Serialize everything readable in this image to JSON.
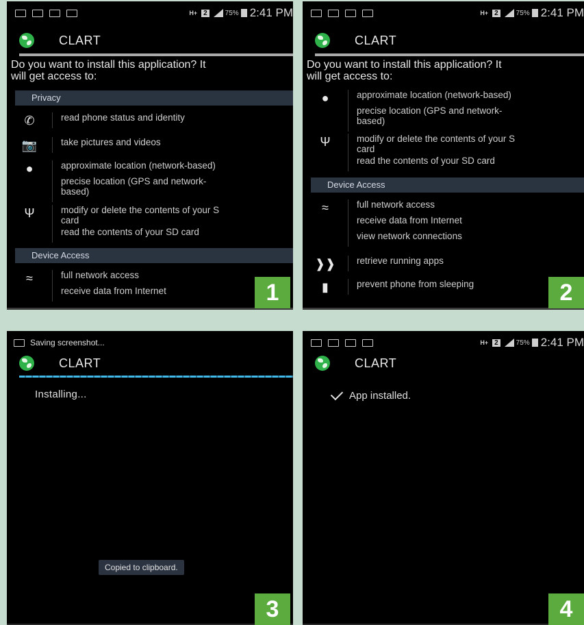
{
  "status_bar": {
    "battery": "75%",
    "time": "2:41 PM",
    "network": "H+",
    "sim": "2",
    "saving": "Saving screenshot..."
  },
  "app": {
    "name": "CLART"
  },
  "install_prompt": {
    "question_line1": "Do you want to install this application? It",
    "question_line2": "will get access to:"
  },
  "sections": {
    "privacy": "Privacy",
    "device_access": "Device Access"
  },
  "permissions": {
    "phone_status": "read phone status and identity",
    "camera": "take pictures and videos",
    "approx_location": "approximate location (network-based)",
    "precise_location_1": "precise location (GPS and network-",
    "precise_location_2": "based)",
    "sd_modify_1": "modify or delete the contents of your S",
    "sd_modify_2": "card",
    "sd_read": "read the contents of your SD card",
    "network_full": "full network access",
    "network_receive": "receive data from Internet",
    "network_view": "view network connections",
    "running_apps": "retrieve running apps",
    "prevent_sleep": "prevent phone from sleeping"
  },
  "progress": {
    "installing": "Installing...",
    "installed": "App installed."
  },
  "toast": "Copied to clipboard.",
  "badges": [
    "1",
    "2",
    "3",
    "4"
  ],
  "colors": {
    "badge": "#5cab3e",
    "background": "#c6dccf",
    "section": "#2a3340",
    "progress": "#40b8e8"
  }
}
